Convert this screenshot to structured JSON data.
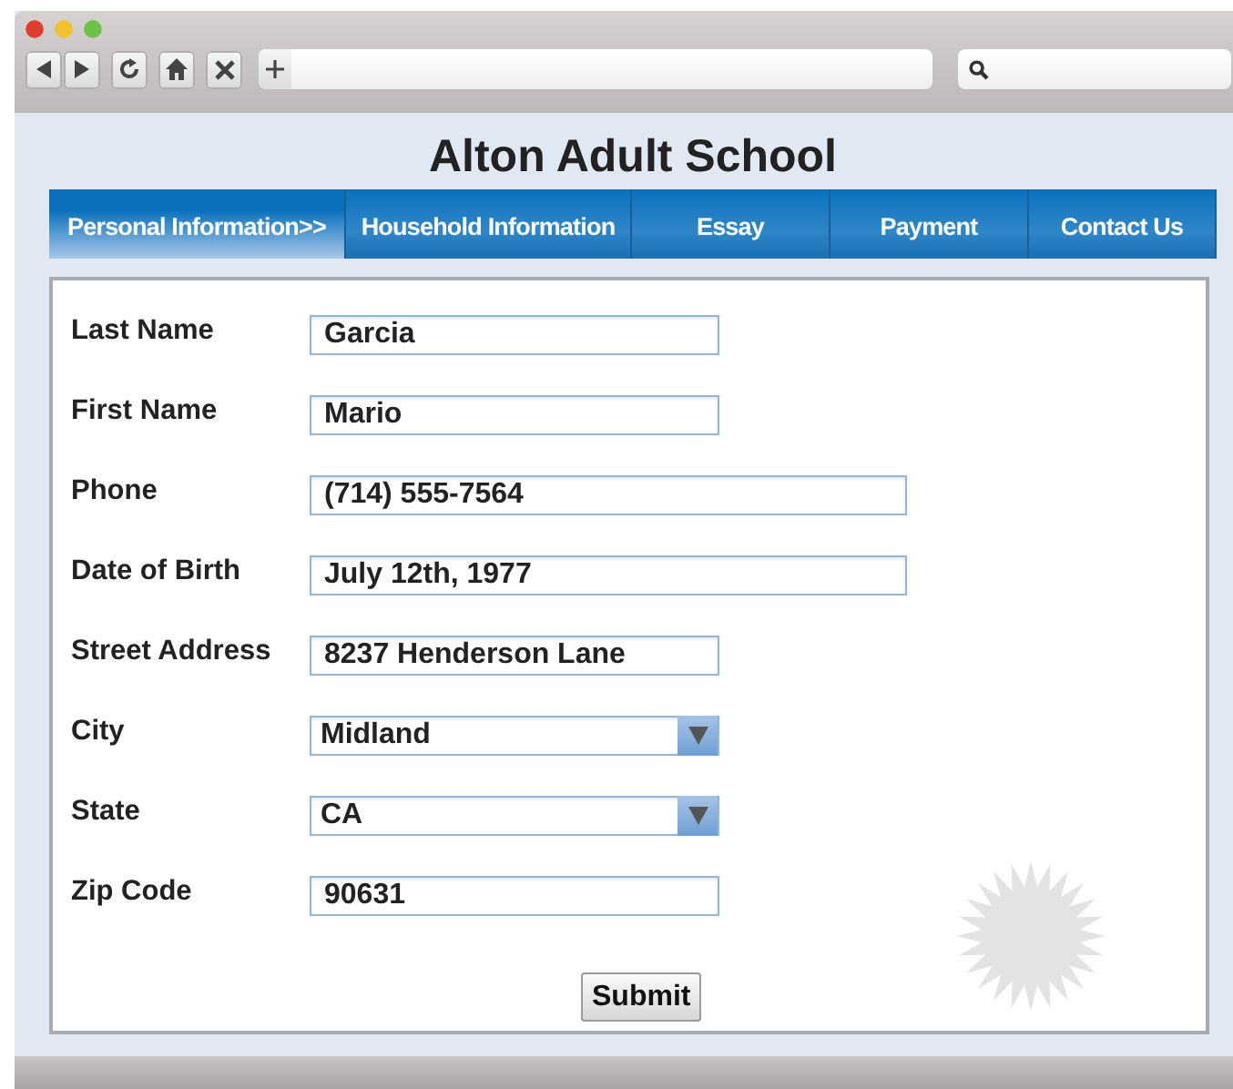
{
  "site_title": "Alton Adult School",
  "tabs": [
    {
      "label": "Personal Information>>",
      "selected": true
    },
    {
      "label": "Household Information",
      "selected": false
    },
    {
      "label": "Essay",
      "selected": false
    },
    {
      "label": "Payment",
      "selected": false
    },
    {
      "label": "Contact Us",
      "selected": false
    }
  ],
  "fields": [
    {
      "label": "Last Name",
      "value": "Garcia",
      "kind": "text"
    },
    {
      "label": "First Name",
      "value": "Mario",
      "kind": "text"
    },
    {
      "label": "Phone",
      "value": "(714) 555-7564",
      "kind": "text"
    },
    {
      "label": "Date of Birth",
      "value": "July 12th, 1977",
      "kind": "text"
    },
    {
      "label": "Street Address",
      "value": "8237 Henderson Lane",
      "kind": "text"
    },
    {
      "label": "City",
      "value": "Midland",
      "kind": "select"
    },
    {
      "label": "State",
      "value": "CA",
      "kind": "select"
    },
    {
      "label": "Zip Code",
      "value": "90631",
      "kind": "text"
    }
  ],
  "submit_button": "Submit"
}
